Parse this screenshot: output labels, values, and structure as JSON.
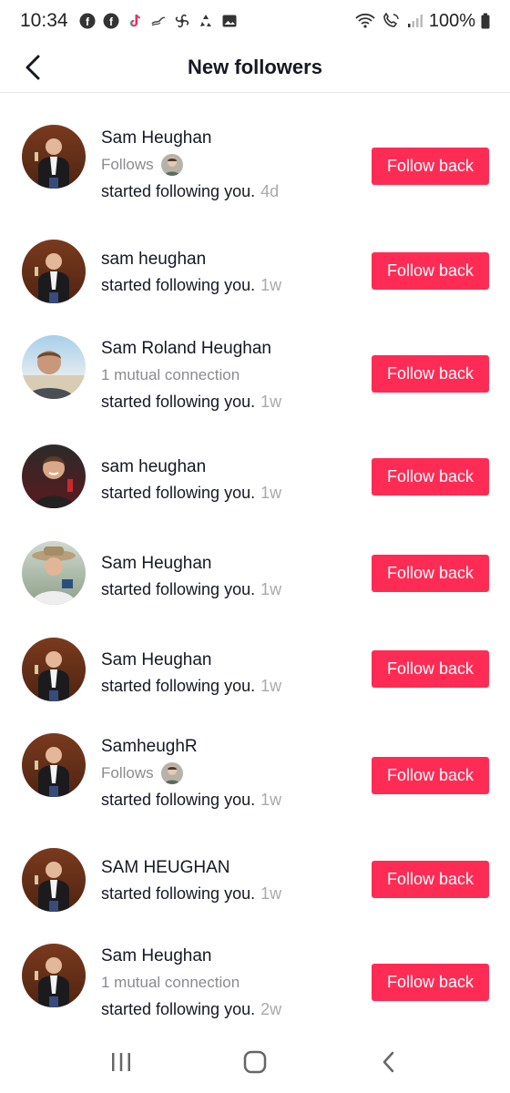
{
  "status_bar": {
    "time": "10:34",
    "battery": "100%",
    "icons_left": [
      "facebook-icon",
      "facebook-icon",
      "tiktok-icon",
      "fan-icon",
      "recycle-icon",
      "gallery-icon"
    ],
    "icons_right": [
      "wifi-icon",
      "call-icon",
      "signal-icon",
      "battery-icon"
    ]
  },
  "header": {
    "title": "New followers"
  },
  "follow_label": "Follow back",
  "colors": {
    "accent": "#fe2c55",
    "muted": "#8a8b91",
    "time": "#a8a9ad"
  },
  "followers": [
    {
      "name": "Sam Heughan",
      "sub": "Follows",
      "sub_avatar": true,
      "action": "started following you.",
      "time": "4d"
    },
    {
      "name": "sam heughan",
      "sub": "",
      "sub_avatar": false,
      "action": "started following you.",
      "time": "1w"
    },
    {
      "name": "Sam Roland Heughan",
      "sub": "1 mutual connection",
      "sub_avatar": false,
      "action": "started following you.",
      "time": "1w"
    },
    {
      "name": "sam heughan",
      "sub": "",
      "sub_avatar": false,
      "action": "started following you.",
      "time": "1w"
    },
    {
      "name": "Sam Heughan",
      "sub": "",
      "sub_avatar": false,
      "action": "started following you.",
      "time": "1w"
    },
    {
      "name": "Sam Heughan",
      "sub": "",
      "sub_avatar": false,
      "action": "started following you.",
      "time": "1w"
    },
    {
      "name": "SamheughR",
      "sub": "Follows",
      "sub_avatar": true,
      "action": "started following you.",
      "time": "1w"
    },
    {
      "name": "SAM HEUGHAN",
      "sub": "",
      "sub_avatar": false,
      "action": "started following you.",
      "time": "1w"
    },
    {
      "name": "Sam Heughan",
      "sub": "1 mutual connection",
      "sub_avatar": false,
      "action": "started following you.",
      "time": "2w"
    }
  ],
  "navbar": {
    "icons": [
      "recent-apps-icon",
      "home-icon",
      "back-nav-icon"
    ]
  }
}
